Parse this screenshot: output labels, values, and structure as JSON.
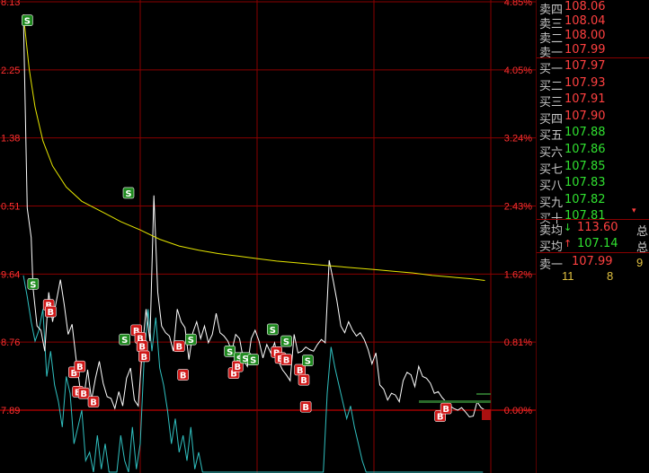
{
  "chart_data": {
    "type": "line",
    "title": "",
    "left_ticks": [
      "8.13",
      "2.25",
      "1.38",
      "0.51",
      "9.64",
      "8.76",
      "7.89"
    ],
    "right_ticks": [
      "4.85%",
      "4.05%",
      "3.24%",
      "2.43%",
      "1.62%",
      "0.81%",
      "0.00%"
    ],
    "ylim_pct": [
      -0.81,
      4.85
    ],
    "x_range": [
      0,
      240
    ],
    "grid": true,
    "series": [
      {
        "color": "#ffffff",
        "x": [
          0,
          2,
          4,
          5,
          7,
          9,
          11,
          13,
          15,
          17,
          19,
          21,
          23,
          25,
          27,
          29,
          31,
          33,
          35,
          37,
          39,
          41,
          43,
          45,
          47,
          49,
          51,
          53,
          55,
          57,
          59,
          61,
          63,
          65,
          67,
          69,
          71,
          73,
          75,
          77,
          79,
          81,
          83,
          85,
          87,
          89,
          91,
          93,
          95,
          97,
          99,
          101,
          103,
          105,
          107,
          109,
          111,
          113,
          115,
          117,
          119,
          121,
          123,
          125,
          127,
          129,
          131,
          133,
          135,
          137,
          139,
          141,
          143,
          145,
          147,
          149,
          151,
          153,
          155,
          157,
          159,
          161,
          163,
          165,
          167,
          169,
          171,
          173,
          175,
          177,
          179,
          181,
          183,
          185,
          187,
          189,
          191,
          193,
          195,
          197,
          199,
          201,
          203,
          205,
          207,
          209,
          211,
          213,
          215,
          217,
          219,
          221,
          223,
          225,
          227,
          229,
          231,
          233,
          235,
          237
        ],
        "values": [
          4.7,
          2.4,
          2.05,
          1.45,
          1.0,
          0.95,
          0.7,
          1.4,
          1.05,
          1.3,
          1.55,
          1.25,
          0.9,
          1.02,
          0.62,
          0.28,
          0.15,
          0.48,
          0.12,
          0.38,
          0.58,
          0.32,
          0.16,
          0.14,
          0.02,
          0.22,
          0.05,
          0.38,
          0.5,
          0.12,
          0.05,
          0.7,
          1.2,
          0.82,
          2.55,
          1.4,
          1.0,
          0.92,
          0.88,
          0.7,
          1.2,
          1.05,
          0.98,
          0.6,
          0.92,
          1.05,
          0.85,
          1.0,
          0.8,
          0.9,
          1.15,
          0.92,
          0.88,
          0.82,
          0.7,
          0.9,
          0.85,
          0.6,
          0.52,
          0.85,
          0.95,
          0.82,
          0.62,
          0.78,
          0.68,
          0.8,
          0.58,
          0.48,
          0.42,
          0.35,
          0.9,
          0.68,
          0.7,
          0.75,
          0.72,
          0.7,
          0.78,
          0.84,
          0.8,
          1.78,
          1.55,
          1.3,
          1.0,
          0.92,
          1.05,
          0.95,
          0.88,
          0.92,
          0.84,
          0.72,
          0.55,
          0.68,
          0.3,
          0.25,
          0.12,
          0.2,
          0.18,
          0.1,
          0.35,
          0.45,
          0.42,
          0.28,
          0.52,
          0.4,
          0.38,
          0.32,
          0.2,
          0.22,
          0.15,
          0.1,
          0.05,
          0.02,
          0.0,
          0.03,
          -0.02,
          -0.08,
          -0.07,
          0.1,
          0.03,
          0.0
        ]
      },
      {
        "color": "#e6e600",
        "x": [
          0,
          3,
          6,
          10,
          15,
          22,
          30,
          40,
          50,
          60,
          70,
          80,
          90,
          100,
          110,
          120,
          130,
          140,
          150,
          160,
          170,
          180,
          190,
          200,
          210,
          220,
          230,
          237
        ],
        "values": [
          4.7,
          4.05,
          3.6,
          3.2,
          2.9,
          2.65,
          2.48,
          2.36,
          2.24,
          2.14,
          2.03,
          1.95,
          1.9,
          1.86,
          1.83,
          1.8,
          1.77,
          1.75,
          1.73,
          1.71,
          1.69,
          1.67,
          1.65,
          1.63,
          1.6,
          1.58,
          1.56,
          1.54
        ]
      }
    ],
    "volume": {
      "color": "#30c0c0",
      "x": [
        0,
        2,
        4,
        6,
        8,
        10,
        12,
        14,
        16,
        18,
        20,
        22,
        24,
        26,
        28,
        30,
        32,
        34,
        36,
        38,
        40,
        42,
        44,
        46,
        48,
        50,
        52,
        54,
        56,
        58,
        60,
        62,
        64,
        66,
        68,
        70,
        72,
        74,
        76,
        78,
        80,
        82,
        84,
        86,
        88,
        90,
        92,
        94,
        96,
        98,
        100,
        102,
        104,
        106,
        108,
        110,
        112,
        114,
        116,
        118,
        120,
        122,
        124,
        126,
        128,
        130,
        132,
        134,
        136,
        138,
        140,
        142,
        144,
        146,
        148,
        150,
        152,
        154,
        156,
        158,
        160,
        162,
        164,
        166,
        168,
        170,
        172,
        174,
        176,
        178,
        180,
        182,
        184,
        186,
        188,
        190,
        192,
        194,
        196,
        198,
        200,
        202,
        204,
        206,
        208,
        210,
        212,
        214,
        216,
        218,
        220,
        222,
        224,
        226,
        228,
        230,
        232,
        234,
        236
      ],
      "values": [
        1.6,
        1.35,
        1.05,
        0.82,
        0.95,
        1.2,
        0.4,
        0.7,
        0.3,
        0.1,
        -0.2,
        0.4,
        0.2,
        -0.4,
        -0.2,
        0.0,
        -0.6,
        -0.5,
        -0.8,
        -0.3,
        -0.7,
        -0.4,
        -0.81,
        -0.81,
        -0.81,
        -0.3,
        -0.6,
        -0.81,
        -0.2,
        -0.7,
        -0.4,
        0.6,
        1.2,
        0.7,
        1.1,
        0.5,
        0.3,
        0.0,
        -0.4,
        -0.1,
        -0.5,
        -0.3,
        -0.6,
        -0.2,
        -0.7,
        -0.5,
        -0.81,
        -0.81,
        -0.81,
        -0.81,
        -0.81,
        -0.81,
        -0.81,
        -0.81,
        -0.81,
        -0.81,
        -0.81,
        -0.81,
        -0.81,
        -0.81,
        -0.81,
        -0.81,
        -0.81,
        -0.81,
        -0.81,
        -0.81,
        -0.81,
        -0.81,
        -0.81,
        -0.81,
        -0.81,
        -0.81,
        -0.81,
        -0.81,
        -0.81,
        -0.81,
        -0.81,
        -0.81,
        0.2,
        0.75,
        0.5,
        0.3,
        0.1,
        -0.1,
        0.05,
        -0.2,
        -0.4,
        -0.6,
        -0.81,
        -0.81,
        -0.81,
        -0.81,
        -0.81,
        -0.81,
        -0.81,
        -0.81,
        -0.81,
        -0.81,
        -0.81,
        -0.81,
        -0.81,
        -0.81,
        -0.81,
        -0.81,
        -0.81,
        -0.81,
        -0.81,
        -0.81,
        -0.81,
        -0.81,
        -0.81,
        -0.81,
        -0.81,
        -0.81,
        -0.81,
        -0.81,
        -0.81,
        -0.81,
        -0.81
      ]
    },
    "markers": [
      {
        "t": "S",
        "x": 2,
        "v": 4.63
      },
      {
        "t": "S",
        "x": 5,
        "v": 1.5
      },
      {
        "t": "B",
        "x": 13,
        "v": 1.25
      },
      {
        "t": "B",
        "x": 14,
        "v": 1.17
      },
      {
        "t": "B",
        "x": 26,
        "v": 0.45
      },
      {
        "t": "B",
        "x": 29,
        "v": 0.52
      },
      {
        "t": "B",
        "x": 28,
        "v": 0.22
      },
      {
        "t": "B",
        "x": 31,
        "v": 0.2
      },
      {
        "t": "B",
        "x": 36,
        "v": 0.1
      },
      {
        "t": "S",
        "x": 52,
        "v": 0.84
      },
      {
        "t": "S",
        "x": 54,
        "v": 2.58
      },
      {
        "t": "B",
        "x": 58,
        "v": 0.95
      },
      {
        "t": "B",
        "x": 60,
        "v": 0.86
      },
      {
        "t": "B",
        "x": 61,
        "v": 0.76
      },
      {
        "t": "B",
        "x": 62,
        "v": 0.64
      },
      {
        "t": "B",
        "x": 80,
        "v": 0.76
      },
      {
        "t": "B",
        "x": 82,
        "v": 0.42
      },
      {
        "t": "S",
        "x": 86,
        "v": 0.84
      },
      {
        "t": "S",
        "x": 106,
        "v": 0.7
      },
      {
        "t": "B",
        "x": 108,
        "v": 0.44
      },
      {
        "t": "S",
        "x": 111,
        "v": 0.62
      },
      {
        "t": "B",
        "x": 110,
        "v": 0.52
      },
      {
        "t": "S",
        "x": 114,
        "v": 0.62
      },
      {
        "t": "S",
        "x": 118,
        "v": 0.6
      },
      {
        "t": "S",
        "x": 128,
        "v": 0.96
      },
      {
        "t": "B",
        "x": 130,
        "v": 0.69
      },
      {
        "t": "B",
        "x": 132,
        "v": 0.62
      },
      {
        "t": "S",
        "x": 135,
        "v": 0.82
      },
      {
        "t": "B",
        "x": 135,
        "v": 0.6
      },
      {
        "t": "B",
        "x": 142,
        "v": 0.48
      },
      {
        "t": "B",
        "x": 144,
        "v": 0.36
      },
      {
        "t": "S",
        "x": 146,
        "v": 0.59
      },
      {
        "t": "B",
        "x": 145,
        "v": 0.04
      },
      {
        "t": "B",
        "x": 214,
        "v": -0.07
      },
      {
        "t": "B",
        "x": 217,
        "v": 0.02
      }
    ]
  },
  "order_book": {
    "sell": [
      {
        "label": "卖四",
        "price": "108.06"
      },
      {
        "label": "卖三",
        "price": "108.04"
      },
      {
        "label": "卖二",
        "price": "108.00"
      },
      {
        "label": "卖一",
        "price": "107.99"
      }
    ],
    "buy": [
      {
        "label": "买一",
        "price": "107.97",
        "cls": "up"
      },
      {
        "label": "买二",
        "price": "107.93",
        "cls": "up"
      },
      {
        "label": "买三",
        "price": "107.91",
        "cls": "up"
      },
      {
        "label": "买四",
        "price": "107.90",
        "cls": "up"
      },
      {
        "label": "买五",
        "price": "107.88",
        "cls": "dn"
      },
      {
        "label": "买六",
        "price": "107.86",
        "cls": "dn"
      },
      {
        "label": "买七",
        "price": "107.85",
        "cls": "dn"
      },
      {
        "label": "买八",
        "price": "107.83",
        "cls": "dn"
      },
      {
        "label": "买九",
        "price": "107.82",
        "cls": "dn"
      },
      {
        "label": "买十",
        "price": "107.81",
        "cls": "dn"
      }
    ],
    "buy_ten_mark": "▾",
    "sell_avg": {
      "label": "卖均",
      "arrow": "↓",
      "price": "113.60",
      "edge": "总"
    },
    "buy_avg": {
      "label": "买均",
      "arrow": "↑",
      "price": "107.14",
      "edge": "总"
    },
    "trade": {
      "label": "卖一",
      "price": "107.99",
      "edge": "9"
    },
    "volumes": [
      "11",
      "8"
    ]
  }
}
